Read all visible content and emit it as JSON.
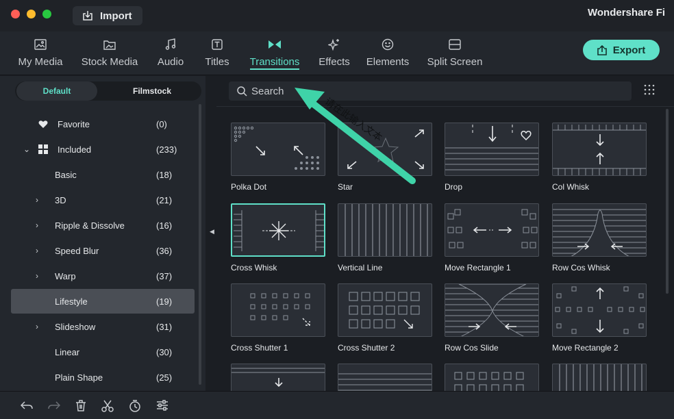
{
  "titlebar": {
    "import_label": "Import",
    "app_title": "Wondershare Fi"
  },
  "toolbar": {
    "tools": [
      {
        "label": "My Media",
        "icon": "image-icon"
      },
      {
        "label": "Stock Media",
        "icon": "folder-image-icon"
      },
      {
        "label": "Audio",
        "icon": "music-note-icon"
      },
      {
        "label": "Titles",
        "icon": "text-box-icon"
      },
      {
        "label": "Transitions",
        "icon": "bowtie-icon",
        "active": true
      },
      {
        "label": "Effects",
        "icon": "sparkle-icon"
      },
      {
        "label": "Elements",
        "icon": "smiley-icon"
      },
      {
        "label": "Split Screen",
        "icon": "split-screen-icon"
      }
    ],
    "export_label": "Export"
  },
  "left_panel": {
    "tabs": {
      "default": "Default",
      "filmstock": "Filmstock"
    },
    "categories": [
      {
        "name": "Favorite",
        "count": "(0)",
        "icon": "heart-icon"
      },
      {
        "name": "Included",
        "count": "(233)",
        "icon": "grid-icon",
        "expanded": true
      },
      {
        "name": "Basic",
        "count": "(18)"
      },
      {
        "name": "3D",
        "count": "(21)",
        "chevron": true
      },
      {
        "name": "Ripple & Dissolve",
        "count": "(16)",
        "chevron": true
      },
      {
        "name": "Speed Blur",
        "count": "(36)",
        "chevron": true
      },
      {
        "name": "Warp",
        "count": "(37)",
        "chevron": true
      },
      {
        "name": "Lifestyle",
        "count": "(19)",
        "selected": true
      },
      {
        "name": "Slideshow",
        "count": "(31)",
        "chevron": true
      },
      {
        "name": "Linear",
        "count": "(30)"
      },
      {
        "name": "Plain Shape",
        "count": "(25)"
      }
    ]
  },
  "search": {
    "placeholder": "Search"
  },
  "transitions": [
    "Polka Dot",
    "Star",
    "Drop",
    "Col Whisk",
    "Cross Whisk",
    "Vertical Line",
    "Move Rectangle 1",
    "Row Cos Whisk",
    "Cross Shutter 1",
    "Cross Shutter 2",
    "Row Cos Slide",
    "Move Rectangle 2"
  ],
  "annotation": {
    "text": "请在此输入文本"
  },
  "colors": {
    "accent": "#5fe0c8",
    "background": "#1b1e23",
    "panel": "#23272d"
  }
}
